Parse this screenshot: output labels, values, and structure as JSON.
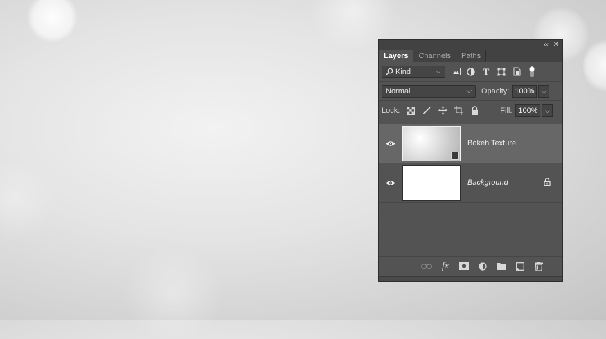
{
  "panel": {
    "tabs": [
      {
        "label": "Layers",
        "active": true
      },
      {
        "label": "Channels",
        "active": false
      },
      {
        "label": "Paths",
        "active": false
      }
    ],
    "collapse_glyph": "‹‹",
    "close_glyph": "✕",
    "filter": {
      "kind_label": "Kind",
      "icons": [
        "image-filter-icon",
        "adjustment-filter-icon",
        "type-filter-icon",
        "shape-filter-icon",
        "smart-object-filter-icon",
        "filter-toggle-icon"
      ]
    },
    "blend_mode": "Normal",
    "opacity_label": "Opacity:",
    "opacity_value": "100%",
    "lock_label": "Lock:",
    "fill_label": "Fill:",
    "fill_value": "100%",
    "lock_icons": [
      "lock-transparent-pixels-icon",
      "lock-image-pixels-icon",
      "lock-position-icon",
      "lock-artboard-icon",
      "lock-all-icon"
    ],
    "layers": [
      {
        "name": "Bokeh Texture",
        "visible": true,
        "selected": true,
        "smart_object": true,
        "locked": false
      },
      {
        "name": "Background",
        "visible": true,
        "selected": false,
        "smart_object": false,
        "locked": true
      }
    ],
    "footer_icons": [
      "link-layers-icon",
      "fx-icon",
      "add-mask-icon",
      "adjustment-layer-icon",
      "new-group-icon",
      "new-layer-icon",
      "delete-layer-icon"
    ],
    "fx_label": "fx"
  },
  "colors": {
    "panel_bg": "#535353",
    "selected_layer_bg": "#676767",
    "canvas_bg": "#e4e4e4"
  }
}
